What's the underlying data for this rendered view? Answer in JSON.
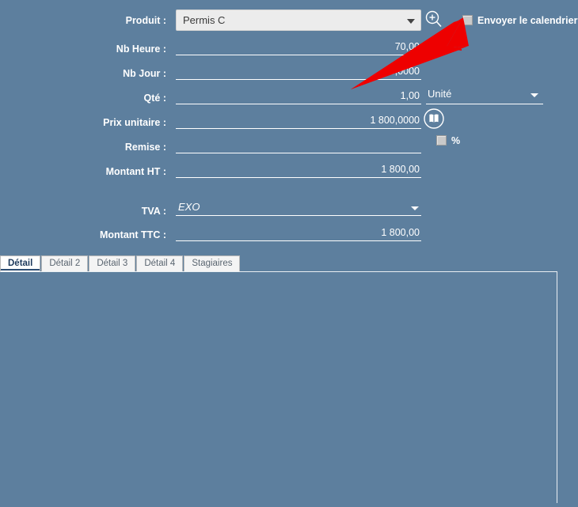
{
  "theme": {
    "background": "#5d7f9e",
    "text": "#ffffff",
    "combo_bg": "#ececec",
    "combo_text": "#3a3a3a",
    "annotation": "#ee0000",
    "tab_active_bg": "#ffffff",
    "tab_inactive_bg": "#f4f4f4",
    "tab_text": "#5a6570",
    "tab_active_text": "#1e3a5c"
  },
  "form": {
    "produit": {
      "label": "Produit :",
      "value": "Permis C",
      "search_icon": "magnifier-plus-icon",
      "dropdown_icon": "chevron-down-icon"
    },
    "envoyer_calendrier": {
      "label": "Envoyer le calendrier",
      "checked": false
    },
    "nb_heure": {
      "label": "Nb Heure :",
      "value": "70,00"
    },
    "nb_jour": {
      "label": "Nb Jour :",
      "value": "10,0000"
    },
    "qte": {
      "label": "Qté :",
      "value": "1,00"
    },
    "unite": {
      "label": "Unité",
      "value": "Unité",
      "dropdown_icon": "chevron-down-icon"
    },
    "prix_unitaire": {
      "label": "Prix unitaire :",
      "value": "1 800,0000",
      "book_icon": "book-icon"
    },
    "remise": {
      "label": "Remise :",
      "value": "",
      "percent_label": "%",
      "percent_checked": false
    },
    "montant_ht": {
      "label": "Montant HT :",
      "value": "1 800,00"
    },
    "tva": {
      "label": "TVA :",
      "value": "EXO",
      "dropdown_icon": "chevron-down-icon"
    },
    "montant_ttc": {
      "label": "Montant TTC :",
      "value": "1 800,00"
    }
  },
  "tabs": {
    "active_index": 0,
    "items": [
      {
        "label": "Détail"
      },
      {
        "label": "Détail 2"
      },
      {
        "label": "Détail 3"
      },
      {
        "label": "Détail 4"
      },
      {
        "label": "Stagiaires"
      }
    ]
  },
  "annotation": {
    "type": "arrow",
    "color": "#ee0000",
    "points_to": "Envoyer le calendrier checkbox"
  }
}
